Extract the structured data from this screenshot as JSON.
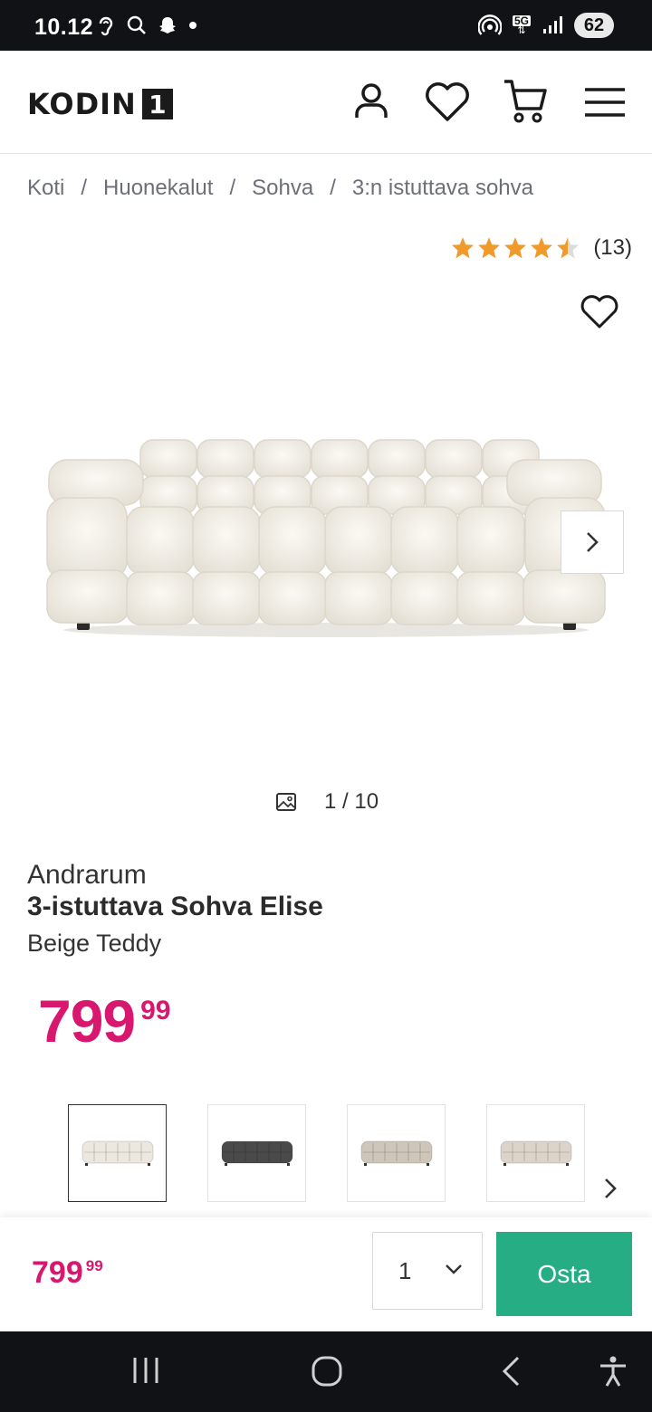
{
  "status_bar": {
    "time": "10.12",
    "battery": "62",
    "network": "5G"
  },
  "header": {
    "logo_text": "KODIN",
    "logo_number": "1",
    "icons": [
      "user-icon",
      "heart-icon",
      "cart-icon",
      "menu-icon"
    ]
  },
  "breadcrumb": [
    "Koti",
    "Huonekalut",
    "Sohva",
    "3:n istuttava sohva"
  ],
  "breadcrumb_separator": "/",
  "rating": {
    "stars": 4.5,
    "count": "(13)"
  },
  "gallery": {
    "counter": "1 / 10"
  },
  "product": {
    "brand": "Andrarum",
    "title": "3-istuttava Sohva Elise",
    "variant": "Beige Teddy",
    "price_int": "799",
    "price_dec": "99"
  },
  "thumbnails": [
    {
      "name": "cream",
      "color": "#ede8df"
    },
    {
      "name": "dark-grey",
      "color": "#4a4a4a"
    },
    {
      "name": "beige",
      "color": "#cfc6ba"
    },
    {
      "name": "light-beige",
      "color": "#ddd4c9"
    }
  ],
  "sticky_bar": {
    "price_int": "799",
    "price_dec": "99",
    "quantity": "1",
    "buy_label": "Osta"
  },
  "colors": {
    "price": "#d8186e",
    "buy_button": "#27ad84",
    "star": "#f09a2c"
  }
}
